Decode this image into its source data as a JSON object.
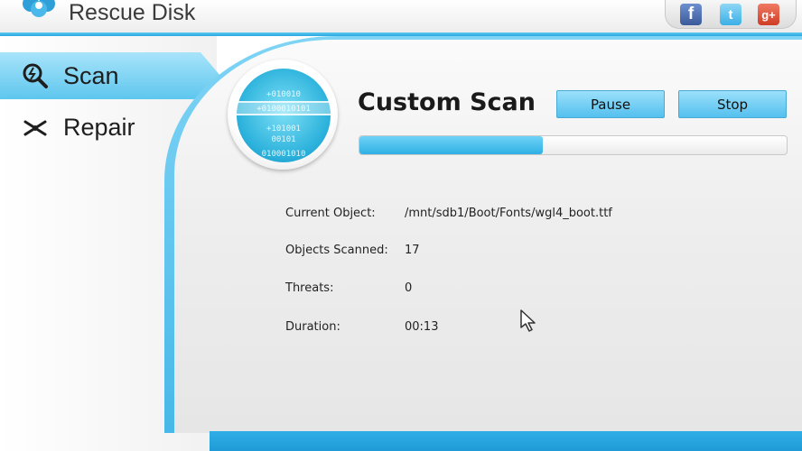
{
  "window": {
    "title": "Rescue Disk",
    "logo_icon": "clover-logo-icon"
  },
  "social": [
    {
      "name": "facebook-icon",
      "glyph": "f"
    },
    {
      "name": "twitter-icon",
      "glyph": "t"
    },
    {
      "name": "google-plus-icon",
      "glyph": "g+"
    }
  ],
  "sidebar": {
    "items": [
      {
        "label": "Scan",
        "icon": "scan-magnifier-icon",
        "active": true
      },
      {
        "label": "Repair",
        "icon": "repair-tools-icon",
        "active": false
      }
    ]
  },
  "scan": {
    "title": "Custom Scan",
    "pause_label": "Pause",
    "stop_label": "Stop",
    "progress_fraction": 0.43,
    "orb_lines": [
      "+010010",
      "+0100010101",
      "+101001",
      "00101",
      "010001010"
    ],
    "details": [
      {
        "label": "Current Object:",
        "value": "/mnt/sdb1/Boot/Fonts/wgl4_boot.ttf"
      },
      {
        "label": "Objects Scanned:",
        "value": "17"
      },
      {
        "label": "Threats:",
        "value": "0"
      },
      {
        "label": "Duration:",
        "value": "00:13"
      }
    ]
  },
  "colors": {
    "accent": "#3db6ea",
    "button": "#7fd3f7",
    "progress": "#2fb0e4"
  }
}
